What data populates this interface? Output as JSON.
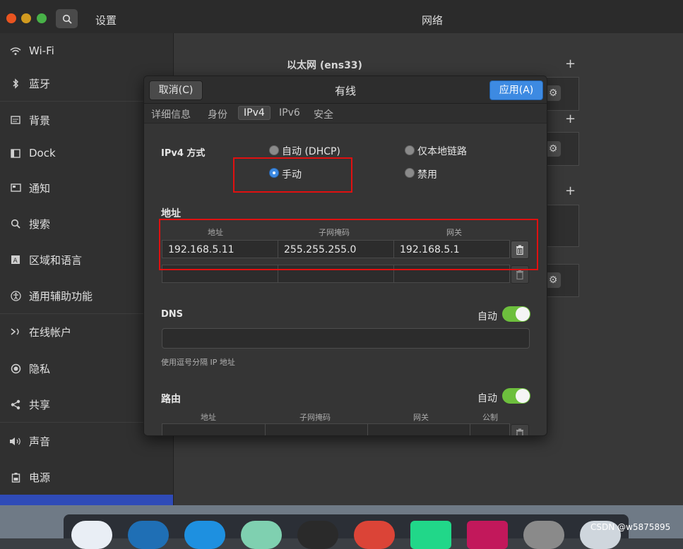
{
  "window": {
    "settings_title": "设置",
    "network_title": "网络"
  },
  "sidebar": {
    "items": [
      {
        "label": "Wi-Fi",
        "icon": "wifi-icon"
      },
      {
        "label": "蓝牙",
        "icon": "bluetooth-icon"
      },
      {
        "label": "背景",
        "icon": "background-icon"
      },
      {
        "label": "Dock",
        "icon": "dock-icon"
      },
      {
        "label": "通知",
        "icon": "notification-icon"
      },
      {
        "label": "搜索",
        "icon": "search-icon"
      },
      {
        "label": "区域和语言",
        "icon": "region-icon"
      },
      {
        "label": "通用辅助功能",
        "icon": "accessibility-icon"
      },
      {
        "label": "在线帐户",
        "icon": "online-accounts-icon"
      },
      {
        "label": "隐私",
        "icon": "privacy-icon"
      },
      {
        "label": "共享",
        "icon": "share-icon"
      },
      {
        "label": "声音",
        "icon": "sound-icon"
      },
      {
        "label": "电源",
        "icon": "power-icon"
      }
    ]
  },
  "network": {
    "ethernet_title": "以太网 (ens33)"
  },
  "dialog": {
    "title": "有线",
    "cancel_label": "取消(C)",
    "apply_label": "应用(A)",
    "tabs": [
      "详细信息",
      "身份",
      "IPv4",
      "IPv6",
      "安全"
    ],
    "active_tab": "IPv4",
    "ipv4_method_label": "IPv4 方式",
    "methods": {
      "auto_dhcp": "自动 (DHCP)",
      "link_local": "仅本地链路",
      "manual": "手动",
      "disable": "禁用"
    },
    "selected_method": "手动",
    "address_section": "地址",
    "address_columns": [
      "地址",
      "子网掩码",
      "网关"
    ],
    "address_rows": [
      {
        "address": "192.168.5.11",
        "netmask": "255.255.255.0",
        "gateway": "192.168.5.1"
      }
    ],
    "dns_label": "DNS",
    "dns_auto_label": "自动",
    "dns_auto": true,
    "dns_value": "",
    "dns_hint": "使用逗号分隔 IP 地址",
    "routes_label": "路由",
    "routes_auto_label": "自动",
    "routes_auto": true,
    "routes_columns": [
      "地址",
      "子网掩码",
      "网关",
      "公制"
    ]
  },
  "watermark": "CSDN @w5875895",
  "colors": {
    "accent": "#3d8ae2",
    "toggle_on": "#6dbf3d",
    "highlight_box": "#e01010",
    "sidebar_active": "#2f4bb8"
  }
}
